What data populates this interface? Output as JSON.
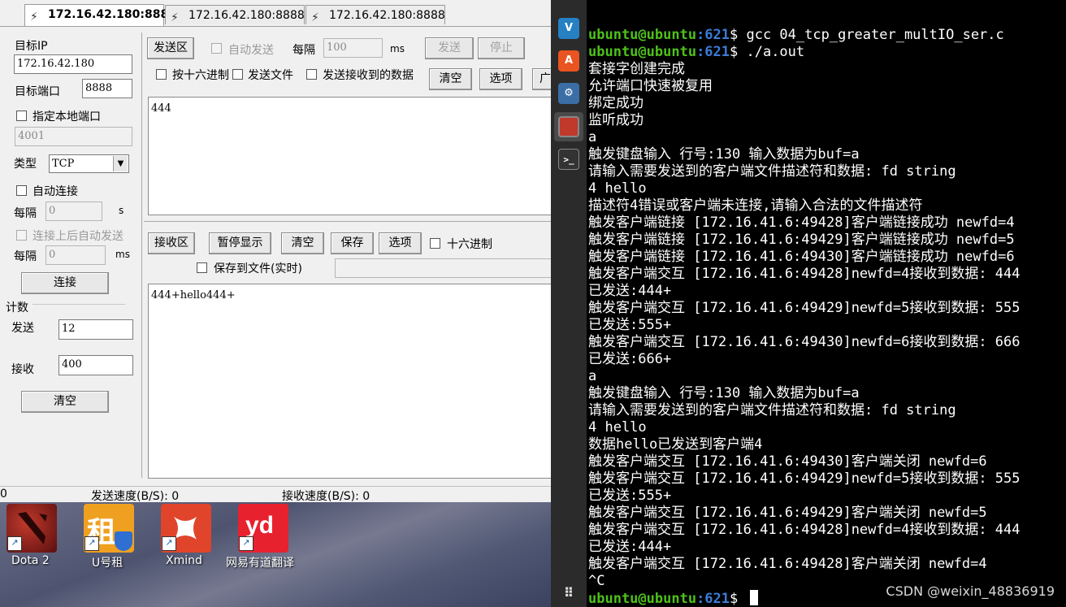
{
  "app": {
    "tabs": [
      "172.16.42.180:8888",
      "172.16.42.180:8888",
      "172.16.42.180:8888"
    ],
    "left": {
      "target_ip_label": "目标IP",
      "target_ip_value": "172.16.42.180",
      "target_port_label": "目标端口",
      "target_port_value": "8888",
      "local_port_label": "指定本地端口",
      "local_port_value": "4001",
      "type_label": "类型",
      "type_value": "TCP",
      "auto_connect_label": "自动连接",
      "interval_label": "每隔",
      "interval_value_1": "0",
      "unit_s": "s",
      "auto_send_after_connect_label": "连接上后自动发送",
      "interval_value_2": "0",
      "unit_ms": "ms",
      "connect_button": "连接",
      "counter_label": "计数",
      "send_label": "发送",
      "send_count": "12",
      "recv_label": "接收",
      "recv_count": "400",
      "clear_button": "清空"
    },
    "send_area": {
      "title_button": "发送区",
      "auto_send_label": "自动发送",
      "interval_label": "每隔",
      "interval_value": "100",
      "unit_ms": "ms",
      "send_button": "发送",
      "stop_button": "停止",
      "hex_label": "按十六进制",
      "send_file_label": "发送文件",
      "send_received_label": "发送接收到的数据",
      "clear_button": "清空",
      "options_button": "选项",
      "cut_button": "广",
      "content": "444"
    },
    "recv_area": {
      "title_button": "接收区",
      "pause_button": "暂停显示",
      "clear_button": "清空",
      "save_button": "保存",
      "options_button": "选项",
      "hex_label": "十六进制",
      "save_to_file_label": "保存到文件(实时)",
      "content": "444+hello444+"
    },
    "status": {
      "left_value": "0",
      "send_speed": "发送速度(B/S): 0",
      "recv_speed": "接收速度(B/S): 0"
    }
  },
  "desktop": {
    "icons": [
      {
        "label": "Dota 2",
        "icon": "dota2-icon",
        "color": "#9b1c1c"
      },
      {
        "label": "U号租",
        "icon": "uhaozu-icon",
        "color": "#f0a020"
      },
      {
        "label": "Xmind",
        "icon": "xmind-icon",
        "color": "#e0452c"
      },
      {
        "label": "网易有道翻译",
        "icon": "youdao-icon",
        "color": "#e8212f"
      }
    ]
  },
  "dock": {
    "items": [
      "vscode-icon",
      "app-store-icon",
      "network-icon",
      "red-app-icon",
      "terminal-icon",
      "app-grid-icon"
    ]
  },
  "terminal": {
    "user_host": "ubuntu@ubuntu",
    "path": ":621",
    "lines": [
      {
        "prompt": true,
        "cmd": "$ gcc 04_tcp_greater_multIO_ser.c"
      },
      {
        "prompt": true,
        "cmd": "$ ./a.out"
      },
      {
        "text": "套接字创建完成"
      },
      {
        "text": "允许端口快速被复用"
      },
      {
        "text": "绑定成功"
      },
      {
        "text": "监听成功"
      },
      {
        "text": "a"
      },
      {
        "text": "触发键盘输入    行号:130 输入数据为buf=a"
      },
      {
        "text": "请输入需要发送到的客户端文件描述符和数据: fd string"
      },
      {
        "text": "4 hello"
      },
      {
        "text": "描述符4错误或客户端未连接,请输入合法的文件描述符"
      },
      {
        "text": "触发客户端链接  [172.16.41.6:49428]客户端链接成功 newfd=4"
      },
      {
        "text": "触发客户端链接  [172.16.41.6:49429]客户端链接成功 newfd=5"
      },
      {
        "text": "触发客户端链接  [172.16.41.6:49430]客户端链接成功 newfd=6"
      },
      {
        "text": "触发客户端交互  [172.16.41.6:49428]newfd=4接收到数据: 444"
      },
      {
        "text": "已发送:444+"
      },
      {
        "text": "触发客户端交互  [172.16.41.6:49429]newfd=5接收到数据: 555"
      },
      {
        "text": "已发送:555+"
      },
      {
        "text": "触发客户端交互  [172.16.41.6:49430]newfd=6接收到数据: 666"
      },
      {
        "text": "已发送:666+"
      },
      {
        "text": "a"
      },
      {
        "text": "触发键盘输入    行号:130 输入数据为buf=a"
      },
      {
        "text": "请输入需要发送到的客户端文件描述符和数据: fd string"
      },
      {
        "text": "4 hello"
      },
      {
        "text": "数据hello已发送到客户端4"
      },
      {
        "text": "触发客户端交互  [172.16.41.6:49430]客户端关闭 newfd=6"
      },
      {
        "text": "触发客户端交互  [172.16.41.6:49429]newfd=5接收到数据: 555"
      },
      {
        "text": "已发送:555+"
      },
      {
        "text": "触发客户端交互  [172.16.41.6:49429]客户端关闭 newfd=5"
      },
      {
        "text": "触发客户端交互  [172.16.41.6:49428]newfd=4接收到数据: 444"
      },
      {
        "text": "已发送:444+"
      },
      {
        "text": "触发客户端交互  [172.16.41.6:49428]客户端关闭 newfd=4"
      },
      {
        "text": "^C"
      },
      {
        "prompt": true,
        "cmd": "$ ",
        "cursor": true
      }
    ],
    "watermark": "CSDN @weixin_48836919"
  }
}
